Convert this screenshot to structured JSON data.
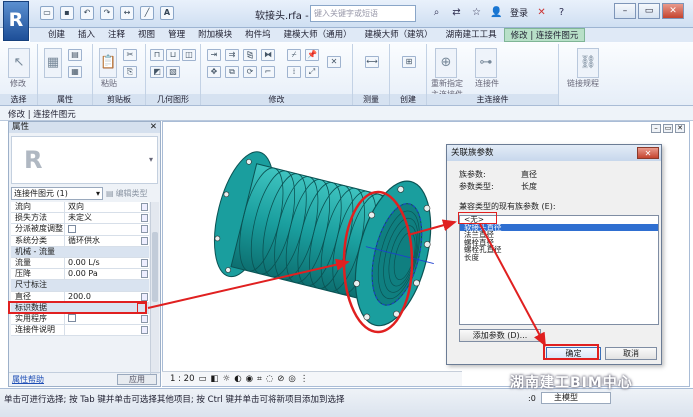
{
  "app": {
    "logo_letter": "R",
    "title": "软接头.rfa - 三",
    "search_placeholder": "键入关键字或短语",
    "login": "登录"
  },
  "qat_icons": [
    "open-icon",
    "save-icon",
    "undo-icon",
    "redo-icon",
    "measure-icon",
    "text-icon"
  ],
  "tabs": [
    "创建",
    "插入",
    "注释",
    "视图",
    "管理",
    "附加模块",
    "构件坞",
    "建模大师（通用）",
    "建模大师（建筑）",
    "湖南建工工具",
    "修改 | 连接件图元"
  ],
  "ribbon": {
    "groups": [
      "选择",
      "属性",
      "剪贴板",
      "几何图形",
      "修改",
      "测量",
      "创建",
      "主连接件"
    ],
    "modify_label": "修改",
    "paste_label": "粘贴",
    "buttons": [
      "重新指定主连接件",
      "连接件",
      "链接规程"
    ]
  },
  "modify_bar": "修改 | 连接件图元",
  "properties": {
    "header": "属性",
    "type_filter": "连接件图元 (1)",
    "edit_type": "编辑类型",
    "rows": [
      {
        "k": "流向",
        "v": "双向",
        "cat": false
      },
      {
        "k": "损失方法",
        "v": "未定义",
        "cat": false
      },
      {
        "k": "分派被度调整",
        "v": "",
        "cat": false,
        "check": true
      },
      {
        "k": "系统分类",
        "v": "循环供水",
        "cat": false
      },
      {
        "k": "机械 - 流量",
        "v": "",
        "cat": true
      },
      {
        "k": "流量",
        "v": "0.00 L/s",
        "cat": false
      },
      {
        "k": "压降",
        "v": "0.00 Pa",
        "cat": false
      },
      {
        "k": "尺寸标注",
        "v": "",
        "cat": true
      },
      {
        "k": "直径",
        "v": "200.0",
        "cat": false
      },
      {
        "k": "标识数据",
        "v": "",
        "cat": true
      },
      {
        "k": "实用程序",
        "v": "",
        "cat": false,
        "check": true
      },
      {
        "k": "连接件说明",
        "v": "",
        "cat": false
      }
    ],
    "help": "属性帮助",
    "apply": "应用"
  },
  "viewport": {
    "scale": "1 : 20"
  },
  "dialog": {
    "title": "关联族参数",
    "family_param_label": "族参数:",
    "family_param_value": "直径",
    "param_type_label": "参数类型:",
    "param_type_value": "长度",
    "compatible_label": "兼容类型的现有族参数 (E):",
    "params": [
      "<无>",
      "软接头直径",
      "法兰直径",
      "螺栓直径",
      "螺栓孔直径",
      "长度"
    ],
    "selected_index": 1,
    "add_param": "添加参数 (D)...",
    "ok": "确定",
    "cancel": "取消"
  },
  "status": {
    "text": "单击可进行选择; 按 Tab 键并单击可选择其他项目; 按 Ctrl 键并单击可将新项目添加到选择",
    "value": ":0",
    "model": "主模型"
  },
  "watermark": "湖南建工BIM中心",
  "colors": {
    "pipe": "#1a9e9e",
    "annotation": "#e02020",
    "selection": "#2f6fd1"
  }
}
